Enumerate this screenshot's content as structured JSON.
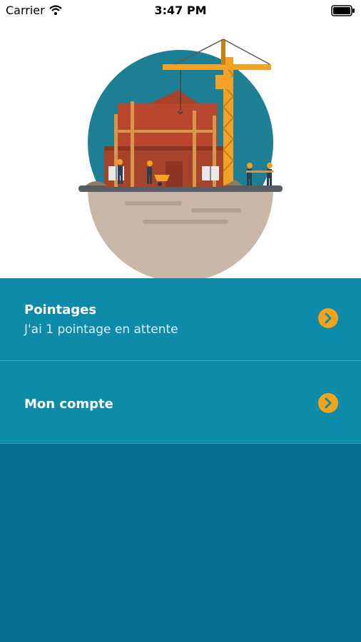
{
  "status_bar": {
    "carrier": "Carrier",
    "time": "3:47 PM",
    "wifi_icon": "wifi-icon",
    "battery_icon": "battery-icon"
  },
  "hero": {
    "illustration": "construction-site-illustration"
  },
  "menu": {
    "items": [
      {
        "title": "Pointages",
        "subtitle": "J'ai 1 pointage en attente",
        "icon": "chevron-right-icon"
      },
      {
        "title": "Mon compte",
        "icon": "chevron-right-icon"
      }
    ]
  },
  "colors": {
    "primary": "#0f8baa",
    "dark_background": "#05718f",
    "accent": "#f5a31a",
    "text_on_primary": "#ffffff"
  }
}
